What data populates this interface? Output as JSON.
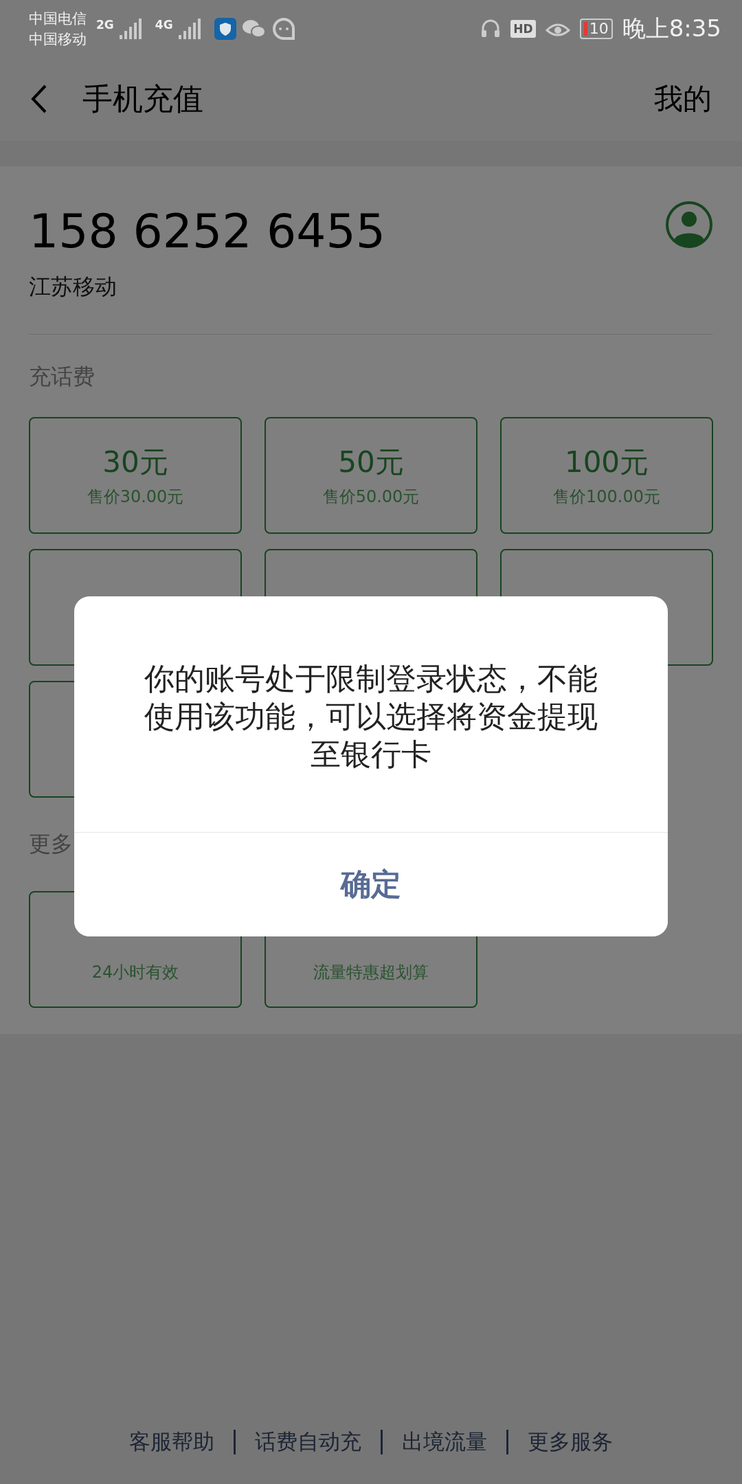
{
  "status_bar": {
    "carriers": [
      "中国电信",
      "中国移动"
    ],
    "network_1": "2G",
    "network_2": "4G",
    "hd": "HD",
    "battery": "10",
    "time": "晚上8:35"
  },
  "header": {
    "title": "手机充值",
    "action": "我的"
  },
  "account": {
    "phone": "158 6252 6455",
    "operator": "江苏移动"
  },
  "recharge": {
    "label": "充话费",
    "tiles": [
      {
        "amount": "30元",
        "price": "售价30.00元"
      },
      {
        "amount": "50元",
        "price": "售价50.00元"
      },
      {
        "amount": "100元",
        "price": "售价100.00元"
      },
      {
        "kind": "covered"
      },
      {
        "kind": "covered"
      },
      {
        "kind": "covered"
      },
      {
        "kind": "covered"
      }
    ]
  },
  "data_plans": {
    "label": "更多",
    "tiles": [
      {
        "price": "24小时有效"
      },
      {
        "price": "流量特惠超划算"
      }
    ]
  },
  "footer_links": [
    "客服帮助",
    "话费自动充",
    "出境流量",
    "更多服务"
  ],
  "dialog": {
    "message": "你的账号处于限制登录状态，不能使用该功能，可以选择将资金提现至银行卡",
    "button": "确定"
  }
}
